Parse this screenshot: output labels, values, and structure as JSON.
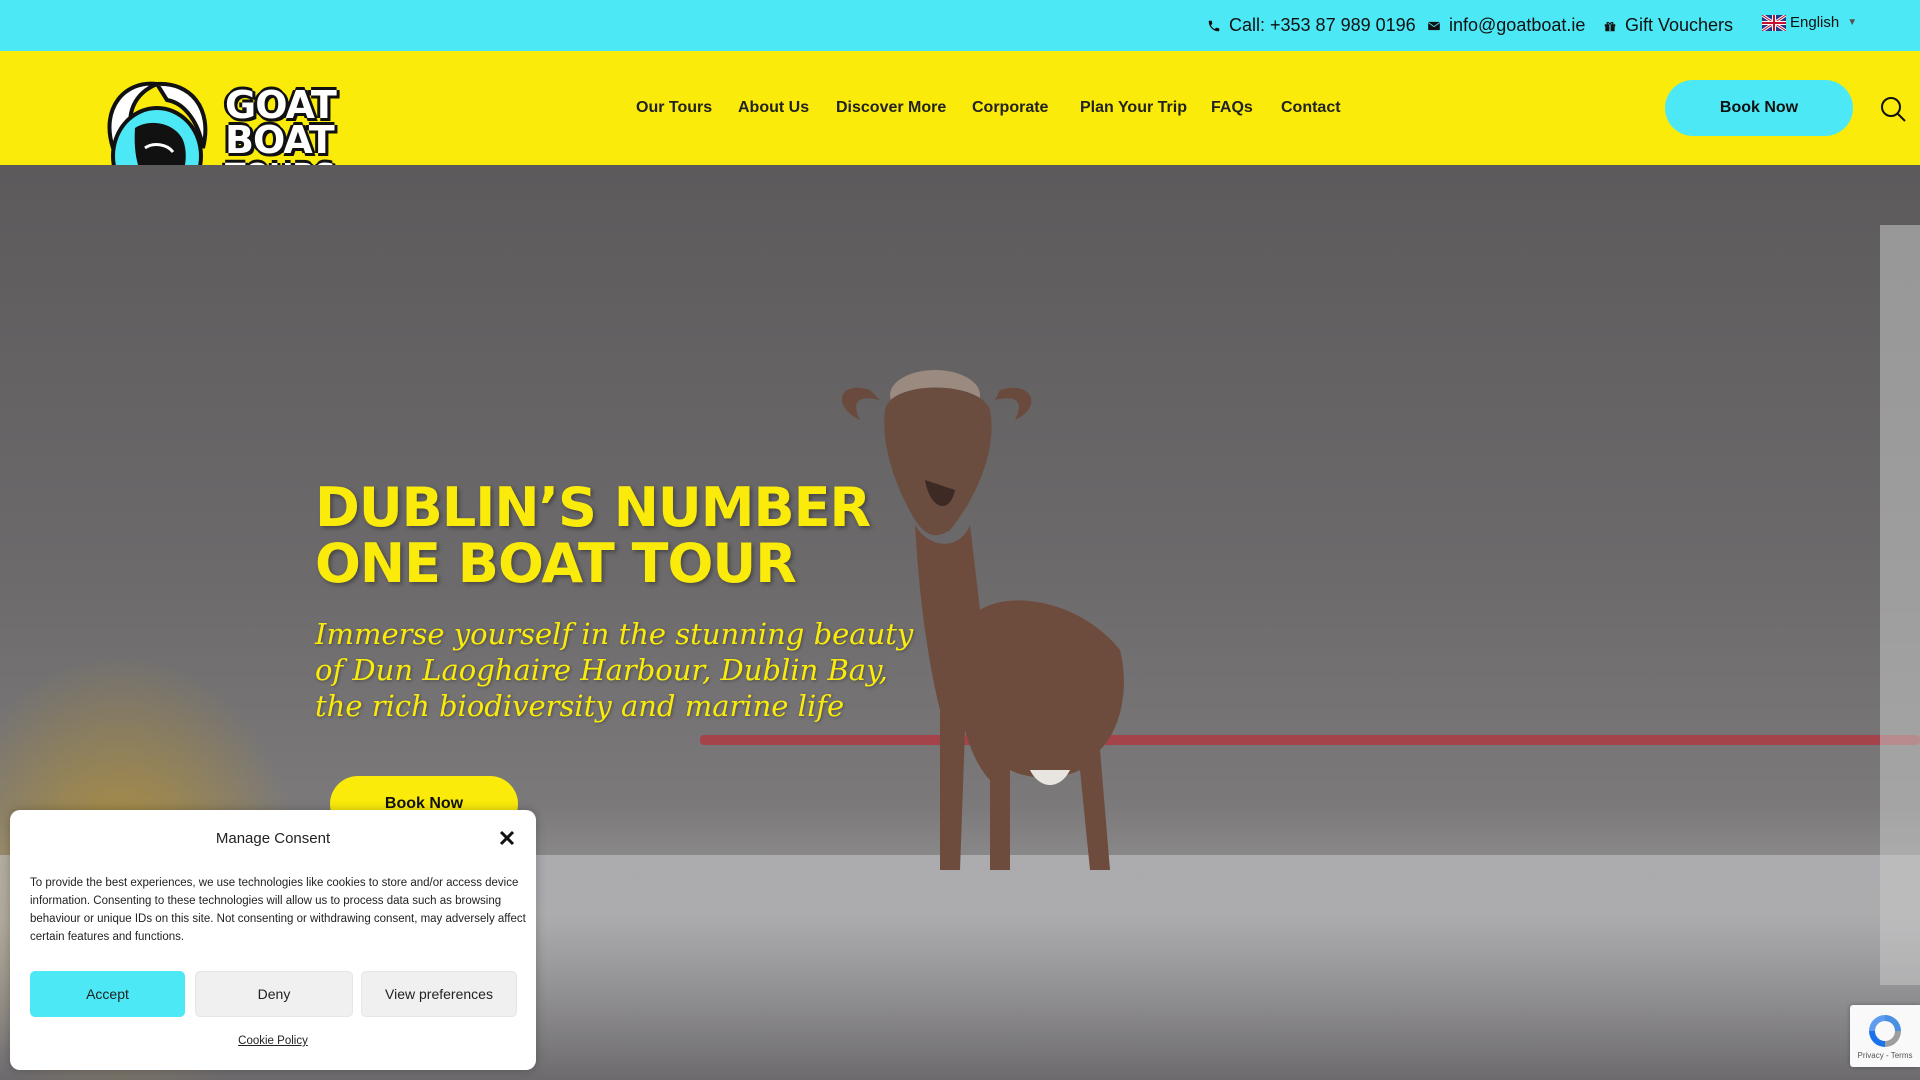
{
  "topbar": {
    "phone": "Call: +353 87 989 0196",
    "email": "info@goatboat.ie",
    "vouchers": "Gift Vouchers",
    "language": "English"
  },
  "logo": {
    "line1": "GOAT",
    "line2": "BOAT",
    "line3": "TOURS"
  },
  "nav": {
    "items": [
      "Our Tours",
      "About Us",
      "Discover More",
      "Corporate",
      "Plan Your Trip",
      "FAQs",
      "Contact"
    ],
    "book_label": "Book Now"
  },
  "hero": {
    "title_line1": "DUBLIN’S NUMBER",
    "title_line2": "ONE BOAT TOUR",
    "subtitle": "Immerse yourself in the stunning beauty of Dun Laoghaire Harbour, Dublin Bay, the rich biodiversity and marine life",
    "book_label": "Book Now"
  },
  "consent": {
    "title": "Manage Consent",
    "text": "To provide the best experiences, we use technologies like cookies to store and/or access device information. Consenting to these technologies will allow us to process data such as browsing behaviour or unique IDs on this site. Not consenting or withdrawing consent, may adversely affect certain features and functions.",
    "accept": "Accept",
    "deny": "Deny",
    "preferences": "View preferences",
    "policy_link": "Cookie Policy"
  },
  "recaptcha": {
    "text": "Privacy - Terms"
  },
  "colors": {
    "cyan": "#4de8f5",
    "yellow": "#faeb0a"
  }
}
